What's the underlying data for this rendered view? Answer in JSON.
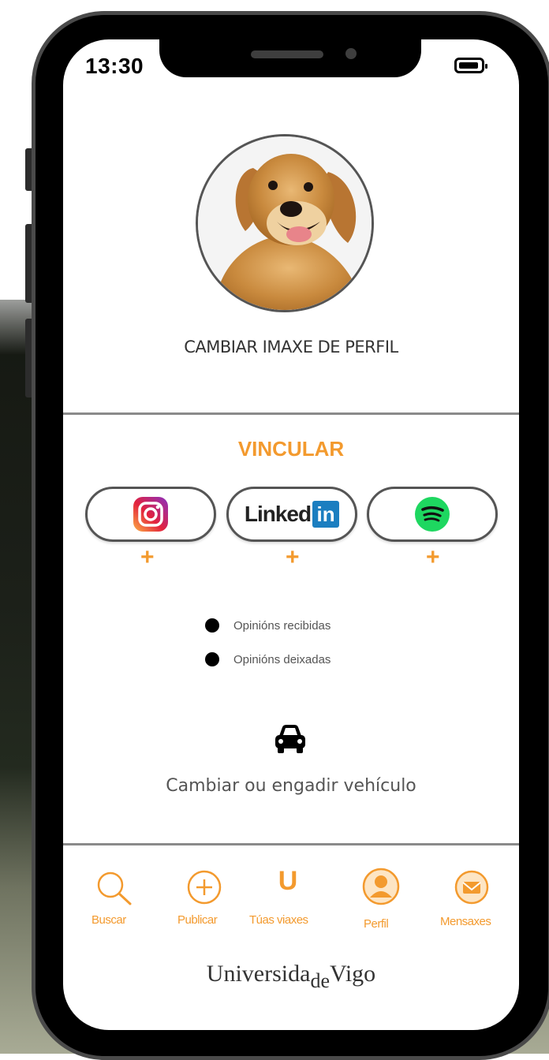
{
  "status_bar": {
    "time": "13:30"
  },
  "profile": {
    "change_photo_label": "CAMBIAR IMAXE DE PERFIL"
  },
  "link_section": {
    "title": "VINCULAR",
    "services": [
      {
        "name": "instagram",
        "icon": "instagram-icon",
        "add": "+"
      },
      {
        "name": "linkedin",
        "logo_text": "Linked",
        "logo_badge": "in",
        "add": "+"
      },
      {
        "name": "spotify",
        "icon": "spotify-icon",
        "add": "+"
      }
    ]
  },
  "opinions": [
    {
      "label": "Opinións recibidas"
    },
    {
      "label": "Opinións deixadas"
    }
  ],
  "vehicle": {
    "icon": "car-icon",
    "label": "Cambiar ou engadir vehículo"
  },
  "bottom_nav": [
    {
      "label": "Buscar",
      "icon": "search-icon"
    },
    {
      "label": "Publicar",
      "icon": "plus-circle-icon"
    },
    {
      "label": "Túas viaxes",
      "icon": "u-icon",
      "glyph": "U"
    },
    {
      "label": "Perfil",
      "icon": "user-icon"
    },
    {
      "label": "Mensaxes",
      "icon": "mail-icon"
    }
  ],
  "footer": {
    "brand_pre": "Universida",
    "brand_de": "de",
    "brand_post": "Vigo"
  },
  "colors": {
    "accent": "#f39a2e",
    "linkedin": "#1b7ec0",
    "spotify": "#1ed760"
  }
}
